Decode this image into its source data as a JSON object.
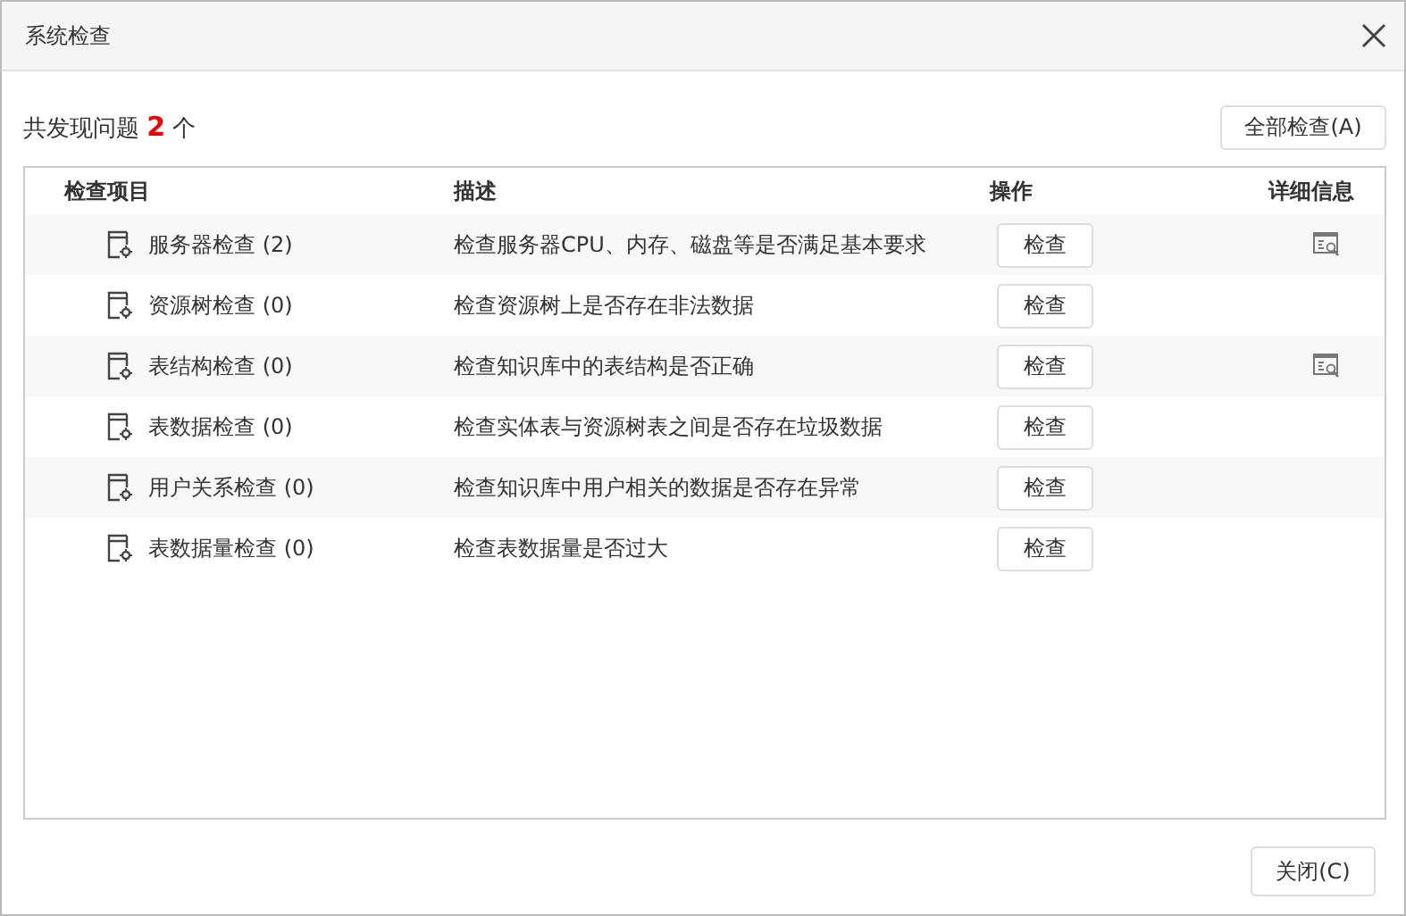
{
  "window": {
    "title": "系统检查"
  },
  "summary": "共发现问题 **2** 个",
  "check_all_button": "全部检查(A)",
  "table": {
    "columns": [
      "检查项目",
      "描述",
      "操作",
      "详细信息"
    ],
    "rows": [
      {
        "item": "服务器检查 (2)",
        "description": "检查服务器CPU、内存、磁盘等是否满足基本要求",
        "action": "检查",
        "has_details": true
      },
      {
        "item": "资源树检查 (0)",
        "description": "检查资源树上是否存在非法数据",
        "action": "检查",
        "has_details": false
      },
      {
        "item": "表结构检查 (0)",
        "description": "检查知识库中的表结构是否正确",
        "action": "检查",
        "has_details": true
      },
      {
        "item": "表数据检查 (0)",
        "description": "检查实体表与资源树表之间是否存在垃圾数据",
        "action": "检查",
        "has_details": false
      },
      {
        "item": "用户关系检查 (0)",
        "description": "检查知识库中用户相关的数据是否存在异常",
        "action": "检查",
        "has_details": false
      },
      {
        "item": "表数据量检查 (0)",
        "description": "检查表数据量是否过大",
        "action": "检查",
        "has_details": false
      }
    ]
  },
  "close_button": "关闭(C)"
}
